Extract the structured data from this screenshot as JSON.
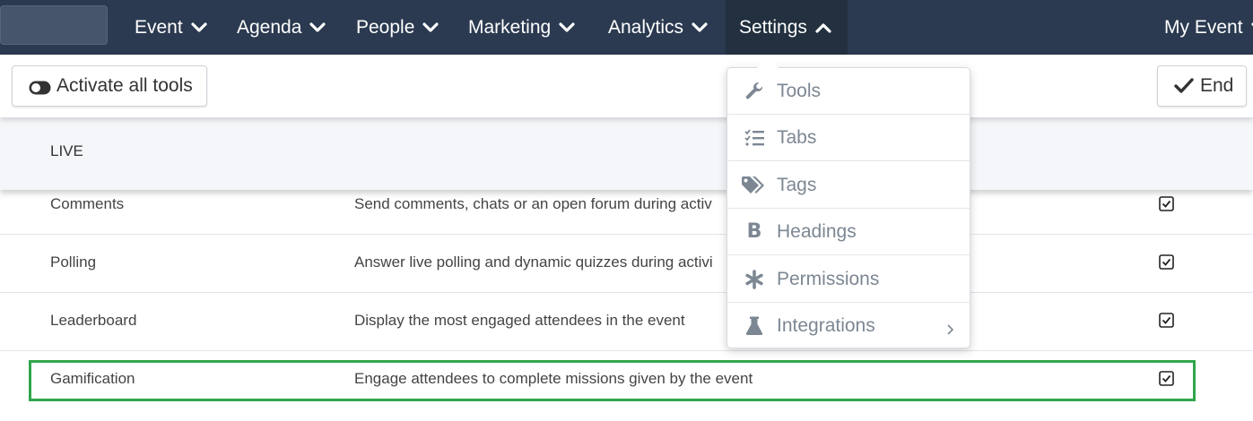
{
  "nav": {
    "items": [
      {
        "label": "Event"
      },
      {
        "label": "Agenda"
      },
      {
        "label": "People"
      },
      {
        "label": "Marketing"
      },
      {
        "label": "Analytics"
      },
      {
        "label": "Settings"
      }
    ],
    "account_label": "My Event"
  },
  "toolbar": {
    "activate_label": "Activate all tools",
    "end_label": "End"
  },
  "section": {
    "title": "LIVE"
  },
  "rows": [
    {
      "name": "Comments",
      "description": "Send comments, chats or an open forum during activ",
      "checked": true
    },
    {
      "name": "Polling",
      "description": "Answer live polling and dynamic quizzes during activi",
      "checked": true
    },
    {
      "name": "Leaderboard",
      "description": "Display the most engaged attendees in the event",
      "checked": true
    },
    {
      "name": "Gamification",
      "description": "Engage attendees to complete missions given by the event",
      "checked": true
    }
  ],
  "settings_menu": {
    "items": [
      {
        "label": "Tools",
        "icon": "wrench-icon"
      },
      {
        "label": "Tabs",
        "icon": "list-check-icon"
      },
      {
        "label": "Tags",
        "icon": "tags-icon"
      },
      {
        "label": "Headings",
        "icon": "bold-b-icon"
      },
      {
        "label": "Permissions",
        "icon": "asterisk-icon"
      },
      {
        "label": "Integrations",
        "icon": "flask-icon"
      }
    ]
  },
  "colors": {
    "navbar": "#2b3a50",
    "highlight": "#2fa64c",
    "menu_text": "#7c8793"
  }
}
